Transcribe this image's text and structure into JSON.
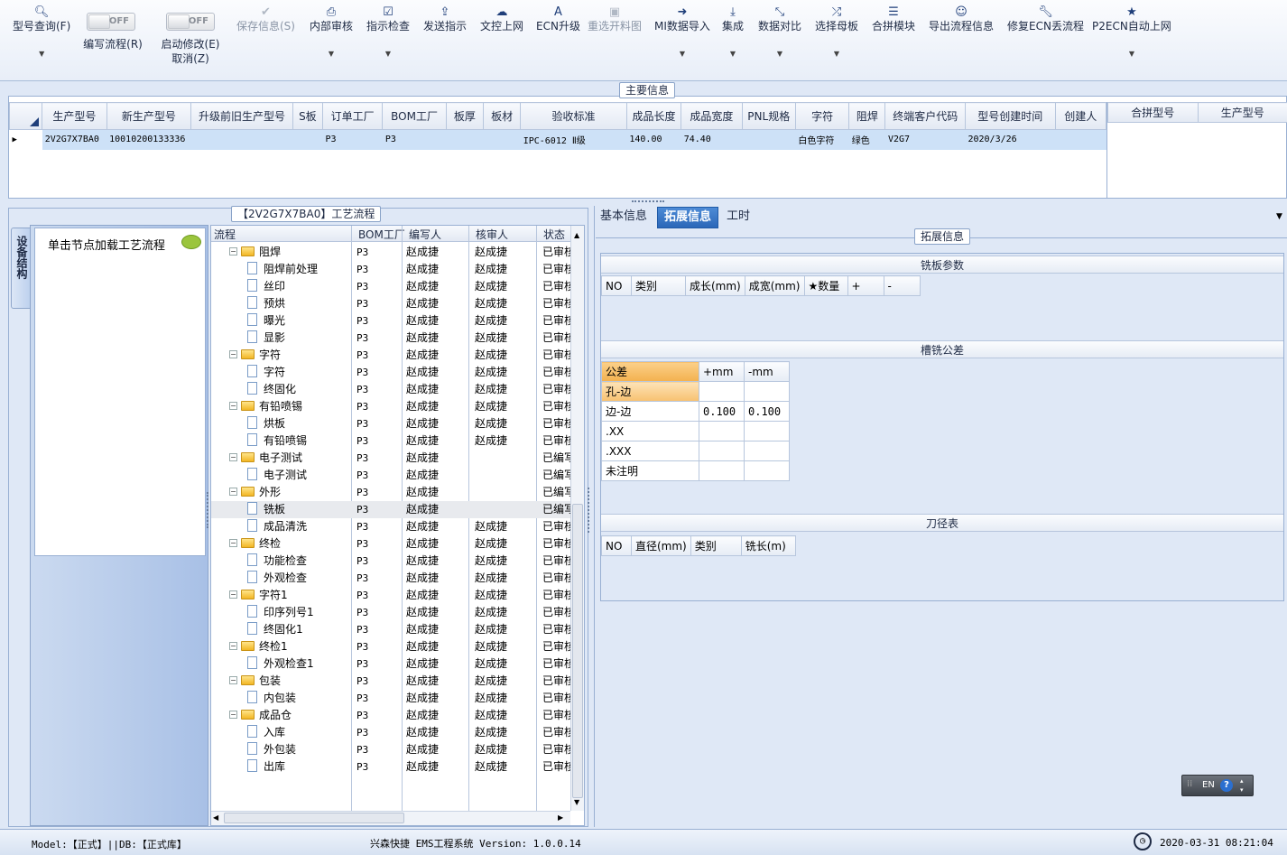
{
  "toolbar": {
    "items": [
      {
        "label": "型号查询(F)",
        "icon": "search-icon",
        "dropdown": true,
        "disabled": false
      },
      {
        "label": "保存信息(S)",
        "icon": "check-icon",
        "dropdown": false,
        "disabled": true
      },
      {
        "label": "内部审核",
        "icon": "print-icon",
        "dropdown": true,
        "disabled": false
      },
      {
        "label": "指示检查",
        "icon": "checkbox-icon",
        "dropdown": true,
        "disabled": false
      },
      {
        "label": "发送指示",
        "icon": "upload-icon",
        "dropdown": false,
        "disabled": false
      },
      {
        "label": "文控上网",
        "icon": "cloud-upload-icon",
        "dropdown": false,
        "disabled": false
      },
      {
        "label": "ECN升级",
        "icon": "font-icon",
        "dropdown": false,
        "disabled": false
      },
      {
        "label": "重选开料图",
        "icon": "image-icon",
        "dropdown": false,
        "disabled": true
      },
      {
        "label": "MI数据导入",
        "icon": "sign-in-icon",
        "dropdown": true,
        "disabled": false
      },
      {
        "label": "集成",
        "icon": "download-icon",
        "dropdown": true,
        "disabled": false
      },
      {
        "label": "数据对比",
        "icon": "compress-icon",
        "dropdown": true,
        "disabled": false
      },
      {
        "label": "选择母板",
        "icon": "shuffle-icon",
        "dropdown": true,
        "disabled": false
      },
      {
        "label": "合拼模块",
        "icon": "list-icon",
        "dropdown": false,
        "disabled": false
      },
      {
        "label": "导出流程信息",
        "icon": "smile-icon",
        "dropdown": false,
        "disabled": false
      },
      {
        "label": "修复ECN丢流程",
        "icon": "wrench-icon",
        "dropdown": false,
        "disabled": false
      },
      {
        "label": "P2ECN自动上网",
        "icon": "star-icon",
        "dropdown": true,
        "disabled": false
      }
    ],
    "toggle1": {
      "state": "OFF",
      "label": "编写流程(R)"
    },
    "toggle2": {
      "state": "OFF",
      "label": "启动修改(E)",
      "sublabel": "取消(Z)"
    }
  },
  "main_info": {
    "title": "主要信息",
    "columns": [
      "生产型号",
      "新生产型号",
      "升级前旧生产型号",
      "S板",
      "订单工厂",
      "BOM工厂",
      "板厚",
      "板材",
      "验收标准",
      "成品长度",
      "成品宽度",
      "PNL规格",
      "字符",
      "阻焊",
      "终端客户代码",
      "型号创建时间",
      "创建人"
    ],
    "row": [
      "2V2G7X7BA0",
      "10010200133336",
      "",
      "",
      "P3",
      "P3",
      "",
      "",
      "IPC-6012 Ⅱ级",
      "140.00",
      "74.40",
      "",
      "白色字符",
      "绿色",
      "V2G7",
      "2020/3/26",
      ""
    ],
    "merge_columns": [
      "合拼型号",
      "生产型号"
    ]
  },
  "left_panel": {
    "side_tab": "设备结构",
    "hint": "单击节点加载工艺流程"
  },
  "process": {
    "title": "【2V2G7X7BA0】工艺流程",
    "columns": [
      "流程",
      "BOM工厂",
      "编写人",
      "核审人",
      "状态"
    ],
    "rows": [
      {
        "level": 0,
        "name": "阻焊",
        "bom": "P3",
        "writer": "赵成捷",
        "reviewer": "赵成捷",
        "status": "已审核"
      },
      {
        "level": 1,
        "name": "阻焊前处理",
        "bom": "P3",
        "writer": "赵成捷",
        "reviewer": "赵成捷",
        "status": "已审核"
      },
      {
        "level": 1,
        "name": "丝印",
        "bom": "P3",
        "writer": "赵成捷",
        "reviewer": "赵成捷",
        "status": "已审核"
      },
      {
        "level": 1,
        "name": "预烘",
        "bom": "P3",
        "writer": "赵成捷",
        "reviewer": "赵成捷",
        "status": "已审核"
      },
      {
        "level": 1,
        "name": "曝光",
        "bom": "P3",
        "writer": "赵成捷",
        "reviewer": "赵成捷",
        "status": "已审核"
      },
      {
        "level": 1,
        "name": "显影",
        "bom": "P3",
        "writer": "赵成捷",
        "reviewer": "赵成捷",
        "status": "已审核"
      },
      {
        "level": 0,
        "name": "字符",
        "bom": "P3",
        "writer": "赵成捷",
        "reviewer": "赵成捷",
        "status": "已审核"
      },
      {
        "level": 1,
        "name": "字符",
        "bom": "P3",
        "writer": "赵成捷",
        "reviewer": "赵成捷",
        "status": "已审核"
      },
      {
        "level": 1,
        "name": "终固化",
        "bom": "P3",
        "writer": "赵成捷",
        "reviewer": "赵成捷",
        "status": "已审核"
      },
      {
        "level": 0,
        "name": "有铅喷锡",
        "bom": "P3",
        "writer": "赵成捷",
        "reviewer": "赵成捷",
        "status": "已审核"
      },
      {
        "level": 1,
        "name": "烘板",
        "bom": "P3",
        "writer": "赵成捷",
        "reviewer": "赵成捷",
        "status": "已审核"
      },
      {
        "level": 1,
        "name": "有铅喷锡",
        "bom": "P3",
        "writer": "赵成捷",
        "reviewer": "赵成捷",
        "status": "已审核"
      },
      {
        "level": 0,
        "name": "电子测试",
        "bom": "P3",
        "writer": "赵成捷",
        "reviewer": "",
        "status": "已编写"
      },
      {
        "level": 1,
        "name": "电子测试",
        "bom": "P3",
        "writer": "赵成捷",
        "reviewer": "",
        "status": "已编写"
      },
      {
        "level": 0,
        "name": "外形",
        "bom": "P3",
        "writer": "赵成捷",
        "reviewer": "",
        "status": "已编写"
      },
      {
        "level": 1,
        "name": "铣板",
        "bom": "P3",
        "writer": "赵成捷",
        "reviewer": "",
        "status": "已编写",
        "selected": true
      },
      {
        "level": 1,
        "name": "成品清洗",
        "bom": "P3",
        "writer": "赵成捷",
        "reviewer": "赵成捷",
        "status": "已审核"
      },
      {
        "level": 0,
        "name": "终检",
        "bom": "P3",
        "writer": "赵成捷",
        "reviewer": "赵成捷",
        "status": "已审核"
      },
      {
        "level": 1,
        "name": "功能检查",
        "bom": "P3",
        "writer": "赵成捷",
        "reviewer": "赵成捷",
        "status": "已审核"
      },
      {
        "level": 1,
        "name": "外观检查",
        "bom": "P3",
        "writer": "赵成捷",
        "reviewer": "赵成捷",
        "status": "已审核"
      },
      {
        "level": 0,
        "name": "字符1",
        "bom": "P3",
        "writer": "赵成捷",
        "reviewer": "赵成捷",
        "status": "已审核"
      },
      {
        "level": 1,
        "name": "印序列号1",
        "bom": "P3",
        "writer": "赵成捷",
        "reviewer": "赵成捷",
        "status": "已审核"
      },
      {
        "level": 1,
        "name": "终固化1",
        "bom": "P3",
        "writer": "赵成捷",
        "reviewer": "赵成捷",
        "status": "已审核"
      },
      {
        "level": 0,
        "name": "终检1",
        "bom": "P3",
        "writer": "赵成捷",
        "reviewer": "赵成捷",
        "status": "已审核"
      },
      {
        "level": 1,
        "name": "外观检查1",
        "bom": "P3",
        "writer": "赵成捷",
        "reviewer": "赵成捷",
        "status": "已审核"
      },
      {
        "level": 0,
        "name": "包装",
        "bom": "P3",
        "writer": "赵成捷",
        "reviewer": "赵成捷",
        "status": "已审核"
      },
      {
        "level": 1,
        "name": "内包装",
        "bom": "P3",
        "writer": "赵成捷",
        "reviewer": "赵成捷",
        "status": "已审核"
      },
      {
        "level": 0,
        "name": "成品仓",
        "bom": "P3",
        "writer": "赵成捷",
        "reviewer": "赵成捷",
        "status": "已审核"
      },
      {
        "level": 1,
        "name": "入库",
        "bom": "P3",
        "writer": "赵成捷",
        "reviewer": "赵成捷",
        "status": "已审核"
      },
      {
        "level": 1,
        "name": "外包装",
        "bom": "P3",
        "writer": "赵成捷",
        "reviewer": "赵成捷",
        "status": "已审核"
      },
      {
        "level": 1,
        "name": "出库",
        "bom": "P3",
        "writer": "赵成捷",
        "reviewer": "赵成捷",
        "status": "已审核"
      }
    ]
  },
  "tabs": [
    {
      "label": "基本信息",
      "active": false
    },
    {
      "label": "拓展信息",
      "active": true
    },
    {
      "label": "工时",
      "active": false
    }
  ],
  "ext": {
    "title": "拓展信息",
    "milling": {
      "title": "铣板参数",
      "columns": [
        "NO",
        "类别",
        "成长(mm)",
        "成宽(mm)",
        "★数量",
        "+",
        "-"
      ]
    },
    "tolerance": {
      "title": "槽铣公差",
      "columns": [
        "公差",
        "+mm",
        "-mm"
      ],
      "rows": [
        [
          "孔-边",
          "",
          ""
        ],
        [
          "边-边",
          "0.100",
          "0.100"
        ],
        [
          ".XX",
          "",
          ""
        ],
        [
          ".XXX",
          "",
          ""
        ],
        [
          "未注明",
          "",
          ""
        ]
      ]
    },
    "cutter": {
      "title": "刀径表",
      "columns": [
        "NO",
        "直径(mm)",
        "类别",
        "铣长(m)"
      ]
    }
  },
  "ime": {
    "lang": "EN",
    "help": "?"
  },
  "status": {
    "left": "Model:【正式】||DB:【正式库】",
    "center": "兴森快捷 EMS工程系统 Version: 1.0.0.14",
    "datetime": "2020-03-31 08:21:04"
  }
}
